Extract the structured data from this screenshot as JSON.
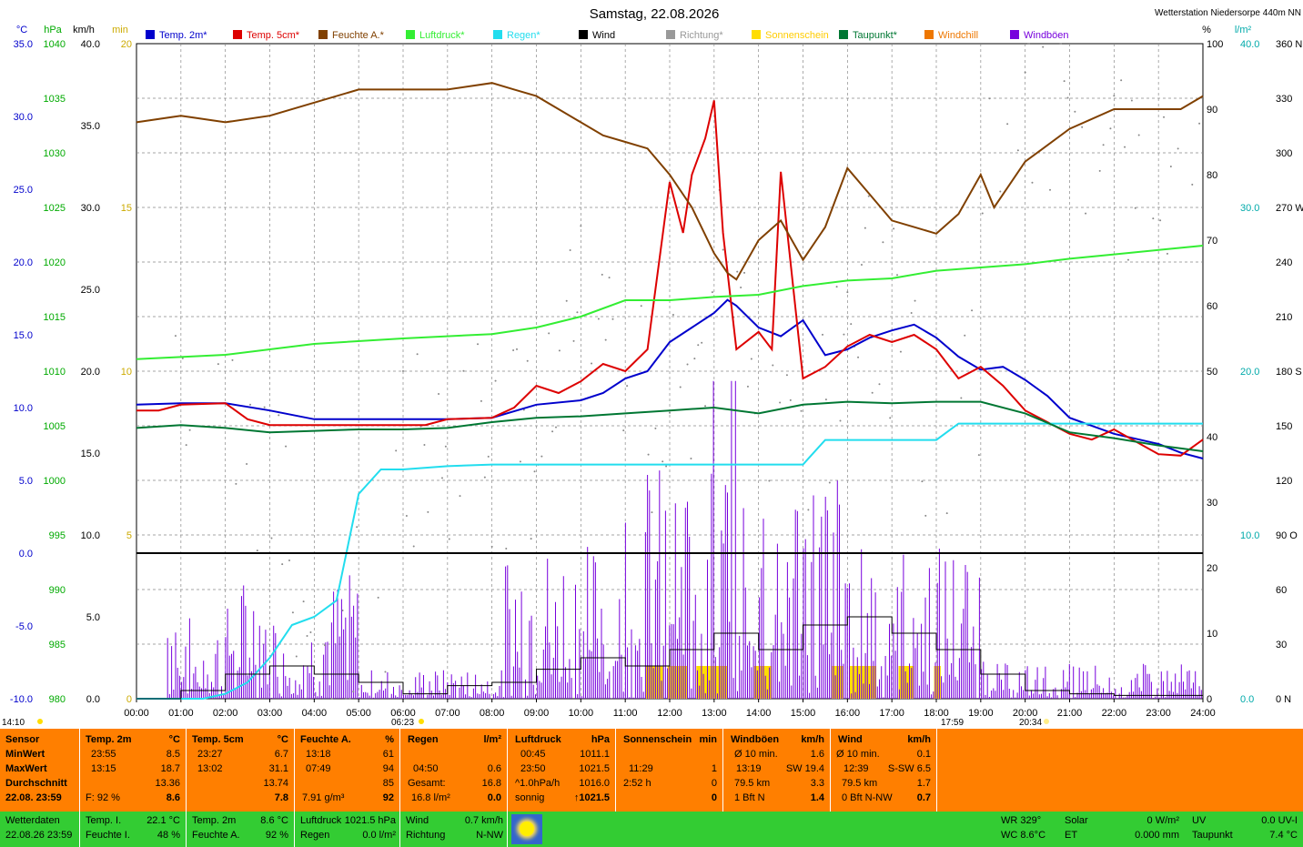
{
  "header": {
    "title": "Samstag, 22.08.2026",
    "station": "Wetterstation Niedersorpe 440m NN"
  },
  "chart_data": {
    "type": "line",
    "title": "Samstag, 22.08.2026",
    "x_ticks": [
      "00:00",
      "01:00",
      "02:00",
      "03:00",
      "04:00",
      "05:00",
      "06:00",
      "07:00",
      "08:00",
      "09:00",
      "10:00",
      "11:00",
      "12:00",
      "13:00",
      "14:00",
      "15:00",
      "16:00",
      "17:00",
      "18:00",
      "19:00",
      "20:00",
      "21:00",
      "22:00",
      "23:00",
      "24:00"
    ],
    "axes": {
      "temp": {
        "unit": "°C",
        "range": [
          -10,
          35
        ],
        "ticks": [
          "35.0",
          "30.0",
          "25.0",
          "20.0",
          "15.0",
          "10.0",
          "5.0",
          "0.0",
          "-5.0",
          "-10.0"
        ],
        "color": "#0000cc"
      },
      "pressure": {
        "unit": "hPa",
        "range": [
          980,
          1040
        ],
        "ticks": [
          "1040",
          "1035",
          "1030",
          "1025",
          "1020",
          "1015",
          "1010",
          "1005",
          "1000",
          "995",
          "990",
          "985",
          "980"
        ],
        "color": "#00aa00"
      },
      "wind": {
        "unit": "km/h",
        "range": [
          0,
          40
        ],
        "ticks": [
          "40.0",
          "35.0",
          "30.0",
          "25.0",
          "20.0",
          "15.0",
          "10.0",
          "5.0",
          "0.0"
        ],
        "color": "#000000"
      },
      "sun": {
        "unit": "min",
        "range": [
          0,
          20
        ],
        "ticks": [
          "20",
          "15",
          "10",
          "5",
          "0"
        ],
        "color": "#ffcc00"
      },
      "humidity": {
        "unit": "%",
        "range": [
          0,
          100
        ],
        "ticks": [
          "100",
          "90",
          "80",
          "70",
          "60",
          "50",
          "40",
          "30",
          "20",
          "10",
          "0"
        ],
        "color": "#000000"
      },
      "rain": {
        "unit": "l/m²",
        "range": [
          0,
          40
        ],
        "ticks": [
          "40.0",
          "30.0",
          "20.0",
          "10.0",
          "0.0"
        ],
        "color": "#00cccc"
      },
      "direction": {
        "range": [
          0,
          360
        ],
        "ticks": [
          "360 N",
          "330",
          "300",
          "270 W",
          "240",
          "210",
          "180 S",
          "150",
          "120",
          "90 O",
          "60",
          "30",
          "0 N"
        ],
        "color": "#000000"
      }
    },
    "legend": [
      {
        "name": "Temp. 2m*",
        "color": "#0000cc"
      },
      {
        "name": "Temp. 5cm*",
        "color": "#dd0000"
      },
      {
        "name": "Feuchte A.*",
        "color": "#804000"
      },
      {
        "name": "Luftdruck*",
        "color": "#33ee33"
      },
      {
        "name": "Regen*",
        "color": "#22ddee"
      },
      {
        "name": "Wind",
        "color": "#000000"
      },
      {
        "name": "Richtung*",
        "color": "#999999"
      },
      {
        "name": "Sonnenschein",
        "color": "#ffdd00"
      },
      {
        "name": "Taupunkt*",
        "color": "#007733"
      },
      {
        "name": "Windchill",
        "color": "#ee7700"
      },
      {
        "name": "Windböen",
        "color": "#7700dd"
      }
    ],
    "series": [
      {
        "name": "Temp. 2m*",
        "axis": "temp",
        "x": [
          0,
          1,
          2,
          3,
          4,
          5,
          6,
          7,
          8,
          9,
          10,
          10.5,
          11,
          11.5,
          12,
          12.5,
          13,
          13.3,
          13.5,
          14,
          14.5,
          15,
          15.5,
          16,
          16.5,
          17,
          17.5,
          18,
          18.5,
          19,
          19.5,
          20,
          20.5,
          21,
          22,
          23,
          23.5,
          24
        ],
        "y": [
          10.2,
          10.3,
          10.3,
          9.8,
          9.2,
          9.2,
          9.2,
          9.2,
          9.3,
          10.2,
          10.5,
          11.0,
          12.0,
          12.5,
          14.5,
          15.5,
          16.5,
          17.4,
          17.0,
          15.5,
          14.9,
          16.0,
          13.6,
          14.0,
          14.8,
          15.3,
          15.7,
          14.8,
          13.5,
          12.6,
          12.8,
          11.9,
          10.8,
          9.3,
          8.2,
          7.5,
          6.9,
          6.5
        ]
      },
      {
        "name": "Temp. 5cm*",
        "axis": "temp",
        "x": [
          0,
          0.5,
          1,
          2,
          2.5,
          3,
          4,
          5,
          6,
          6.5,
          7,
          8,
          8.5,
          9,
          9.5,
          10,
          10.5,
          11,
          11.5,
          12,
          12.3,
          12.5,
          12.8,
          13,
          13.2,
          13.5,
          14,
          14.3,
          14.5,
          15,
          15.5,
          16,
          16.5,
          17,
          17.5,
          18,
          18.5,
          19,
          19.5,
          20,
          21,
          21.5,
          22,
          23,
          23.5,
          24
        ],
        "y": [
          9.8,
          9.8,
          10.2,
          10.3,
          9.2,
          8.8,
          8.8,
          8.8,
          8.8,
          8.8,
          9.2,
          9.3,
          10.0,
          11.5,
          11.0,
          11.8,
          13.0,
          12.5,
          14.0,
          25.5,
          22.0,
          26.0,
          28.5,
          31.1,
          22.0,
          14.0,
          15.2,
          14.0,
          26.2,
          12.0,
          12.8,
          14.2,
          15.0,
          14.5,
          15.0,
          14.0,
          12.0,
          12.8,
          11.5,
          9.8,
          8.2,
          7.8,
          8.5,
          6.8,
          6.7,
          7.8
        ]
      },
      {
        "name": "Feuchte A.*",
        "axis": "humidity",
        "x": [
          0,
          1,
          2,
          3,
          4,
          5,
          6,
          7,
          8,
          8.5,
          9,
          9.5,
          10,
          10.5,
          11,
          11.5,
          12,
          12.5,
          13,
          13.3,
          13.5,
          14,
          14.5,
          15,
          15.5,
          16,
          16.5,
          17,
          17.5,
          18,
          18.5,
          19,
          19.3,
          19.5,
          20,
          21,
          22,
          23,
          23.5,
          24
        ],
        "y": [
          88,
          89,
          88,
          89,
          91,
          93,
          93,
          93,
          94,
          93,
          92,
          90,
          88,
          86,
          85,
          84,
          80,
          75,
          68,
          65,
          64,
          70,
          73,
          67,
          72,
          81,
          77,
          73,
          72,
          71,
          74,
          80,
          75,
          77,
          82,
          87,
          90,
          90,
          90,
          92
        ]
      },
      {
        "name": "Luftdruck*",
        "axis": "pressure",
        "x": [
          0,
          2,
          4,
          6,
          8,
          9,
          10,
          11,
          12,
          13,
          14,
          15,
          16,
          17,
          18,
          19,
          20,
          21,
          22,
          23,
          24
        ],
        "y": [
          1011.1,
          1011.5,
          1012.5,
          1013.0,
          1013.4,
          1014.0,
          1015.0,
          1016.5,
          1016.5,
          1016.8,
          1017.0,
          1017.8,
          1018.3,
          1018.5,
          1019.2,
          1019.5,
          1019.8,
          1020.3,
          1020.7,
          1021.1,
          1021.5
        ]
      },
      {
        "name": "Regen*",
        "axis": "rain",
        "x": [
          0,
          1.5,
          2,
          2.5,
          3,
          3.5,
          4,
          4.5,
          5,
          5.5,
          6,
          7,
          8,
          10,
          12,
          14,
          15,
          15.5,
          16,
          17,
          18,
          18.5,
          19,
          20,
          22,
          24
        ],
        "y": [
          0,
          0,
          0.3,
          1.0,
          2.5,
          4.5,
          5.0,
          6.0,
          12.5,
          14.0,
          14.0,
          14.2,
          14.3,
          14.3,
          14.3,
          14.3,
          14.3,
          15.8,
          15.8,
          15.8,
          15.8,
          16.8,
          16.8,
          16.8,
          16.8,
          16.8
        ]
      },
      {
        "name": "Taupunkt*",
        "axis": "temp",
        "x": [
          0,
          1,
          2,
          3,
          4,
          5,
          6,
          7,
          8,
          9,
          10,
          11,
          12,
          13,
          14,
          15,
          16,
          17,
          18,
          19,
          20,
          21,
          22,
          23,
          24
        ],
        "y": [
          8.6,
          8.8,
          8.6,
          8.3,
          8.4,
          8.5,
          8.5,
          8.6,
          9.0,
          9.3,
          9.4,
          9.6,
          9.8,
          10.0,
          9.6,
          10.2,
          10.4,
          10.3,
          10.4,
          10.4,
          9.6,
          8.3,
          7.9,
          7.4,
          7.0
        ]
      },
      {
        "name": "Wind",
        "axis": "wind",
        "x": [
          0,
          1,
          2,
          3,
          4,
          5,
          6,
          7,
          8,
          9,
          10,
          11,
          12,
          13,
          14,
          15,
          16,
          17,
          18,
          19,
          20,
          21,
          22,
          23,
          24
        ],
        "y": [
          0,
          0.5,
          1.5,
          2.0,
          1.5,
          1.0,
          0.3,
          0.8,
          1.0,
          1.8,
          2.5,
          2.0,
          3.0,
          4.0,
          3.0,
          4.5,
          5.0,
          4.0,
          3.0,
          1.5,
          0.5,
          0.3,
          0.2,
          0.2,
          0.2
        ]
      }
    ]
  },
  "axis_bottom": {
    "time_left": "14:10",
    "sunrise": "06:23",
    "sunset_a": "17:59",
    "sunset_b": "20:34"
  },
  "stats": {
    "sensor": {
      "title": "Sensor",
      "r1": "MinWert",
      "r2": "MaxWert",
      "r3": "Durchschnitt",
      "r4": "22.08. 23:59"
    },
    "temp2m": {
      "title": "Temp. 2m",
      "unit": "°C",
      "r1a": "23:55",
      "r1b": "8.5",
      "r2a": "13:15",
      "r2b": "18.7",
      "r3b": "13.36",
      "r4a": "F: 92 %",
      "r4b": "8.6"
    },
    "temp5cm": {
      "title": "Temp. 5cm",
      "unit": "°C",
      "r1a": "23:27",
      "r1b": "6.7",
      "r2a": "13:02",
      "r2b": "31.1",
      "r3b": "13.74",
      "r4b": "7.8"
    },
    "feuchte": {
      "title": "Feuchte A.",
      "unit": "%",
      "r1a": "13:18",
      "r1b": "61",
      "r2a": "07:49",
      "r2b": "94",
      "r3b": "85",
      "r4a": "7.91 g/m³",
      "r4b": "92"
    },
    "regen": {
      "title": "Regen",
      "unit": "l/m²",
      "r2a": "04:50",
      "r2b": "0.6",
      "r3a": "Gesamt:",
      "r3b": "16.8",
      "r4a": "16.8 l/m²",
      "r4b": "0.0"
    },
    "luftdruck": {
      "title": "Luftdruck",
      "unit": "hPa",
      "r1a": "00:45",
      "r1b": "1011.1",
      "r2a": "23:50",
      "r2b": "1021.5",
      "r3a": "^1.0hPa/h",
      "r3b": "1016.0",
      "r4a": "sonnig",
      "r4b": "↑1021.5"
    },
    "sonne": {
      "title": "Sonnenschein",
      "unit": "min",
      "r2a": "11:29",
      "r2b": "1",
      "r3a": "2:52 h",
      "r3b": "0",
      "r4b": "0"
    },
    "windboeen": {
      "title": "Windböen",
      "unit": "km/h",
      "r1a": "Ø 10 min.",
      "r1b": "1.6",
      "r2a": "13:19",
      "r2c": "SW 19.4",
      "r3a": "79.5 km",
      "r3b": "3.3",
      "r4a": "1 Bft N",
      "r4b": "1.4"
    },
    "wind": {
      "title": "Wind",
      "unit": "km/h",
      "r1a": "Ø 10 min.",
      "r1b": "0.1",
      "r2a": "12:39",
      "r2c": "S-SW 6.5",
      "r3a": "79.5 km",
      "r3b": "1.7",
      "r4a": "0 Bft N-NW",
      "r4b": "0.7"
    }
  },
  "bottom": {
    "label": "Wetterdaten",
    "date": "22.08.26 23:59",
    "tempI_label": "Temp. I.",
    "tempI": "22.1 °C",
    "feuchteI_label": "Feuchte I.",
    "feuchteI": "48 %",
    "temp2m_label": "Temp. 2m",
    "temp2m": "8.6 °C",
    "feuchteA_label": "Feuchte A.",
    "feuchteA": "92 %",
    "luftdruck_label": "Luftdruck",
    "luftdruck": "1021.5 hPa",
    "regen_label": "Regen",
    "regen": "0.0 l/m²",
    "wind_label": "Wind",
    "wind": "0.7 km/h",
    "richtung_label": "Richtung",
    "richtung": "N-NW",
    "wr": "WR 329°",
    "wc": "WC 8.6°C",
    "solar_label": "Solar",
    "solar": "0 W/m²",
    "et_label": "ET",
    "et": "0.000 mm",
    "uv_label": "UV",
    "uv": "0.0 UV-I",
    "taupunkt_label": "Taupunkt",
    "taupunkt": "7.4 °C"
  }
}
